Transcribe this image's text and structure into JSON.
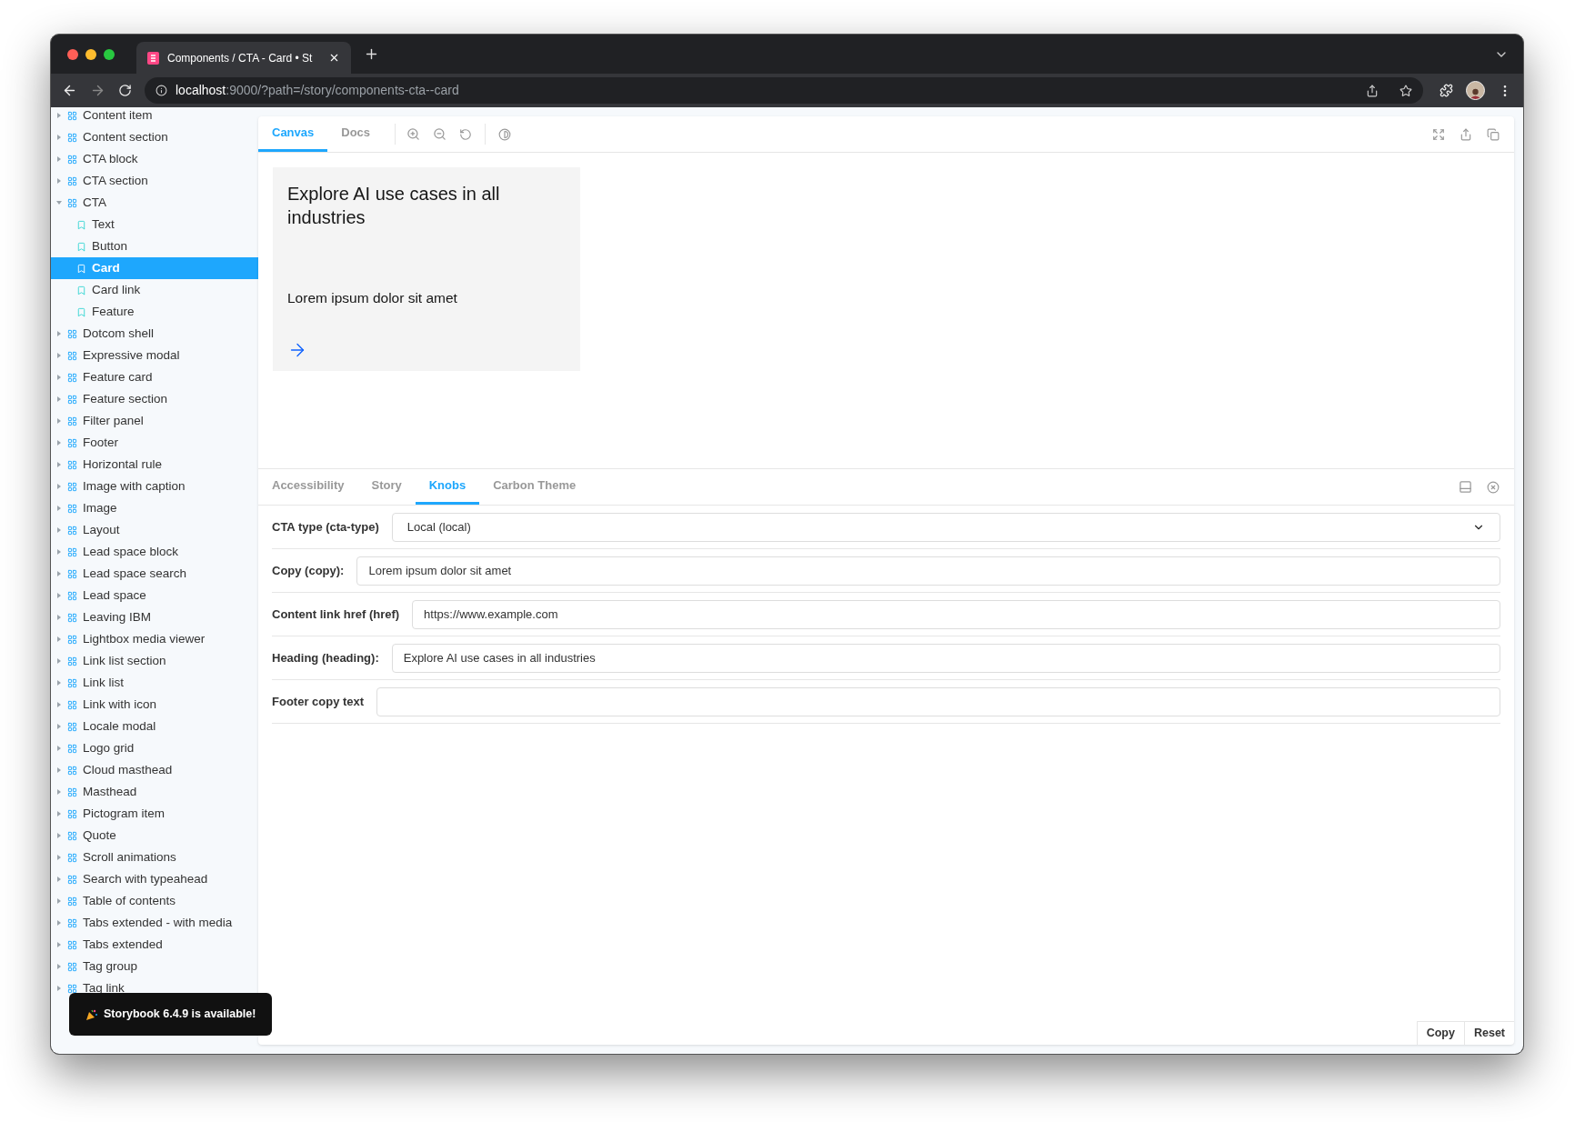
{
  "browser": {
    "tab_title": "Components / CTA - Card • St",
    "url": {
      "host": "localhost",
      "path": ":9000/?path=/story/components-cta--card"
    }
  },
  "sidebar": {
    "items": [
      {
        "label": "Content item",
        "kind": "component",
        "expanded": false
      },
      {
        "label": "Content section",
        "kind": "component",
        "expanded": false
      },
      {
        "label": "CTA block",
        "kind": "component",
        "expanded": false
      },
      {
        "label": "CTA section",
        "kind": "component",
        "expanded": false
      },
      {
        "label": "CTA",
        "kind": "component",
        "expanded": true,
        "children": [
          {
            "label": "Text",
            "kind": "story",
            "selected": false
          },
          {
            "label": "Button",
            "kind": "story",
            "selected": false
          },
          {
            "label": "Card",
            "kind": "story",
            "selected": true
          },
          {
            "label": "Card link",
            "kind": "story",
            "selected": false
          },
          {
            "label": "Feature",
            "kind": "story",
            "selected": false
          }
        ]
      },
      {
        "label": "Dotcom shell",
        "kind": "component",
        "expanded": false
      },
      {
        "label": "Expressive modal",
        "kind": "component",
        "expanded": false
      },
      {
        "label": "Feature card",
        "kind": "component",
        "expanded": false
      },
      {
        "label": "Feature section",
        "kind": "component",
        "expanded": false
      },
      {
        "label": "Filter panel",
        "kind": "component",
        "expanded": false
      },
      {
        "label": "Footer",
        "kind": "component",
        "expanded": false
      },
      {
        "label": "Horizontal rule",
        "kind": "component",
        "expanded": false
      },
      {
        "label": "Image with caption",
        "kind": "component",
        "expanded": false
      },
      {
        "label": "Image",
        "kind": "component",
        "expanded": false
      },
      {
        "label": "Layout",
        "kind": "component",
        "expanded": false
      },
      {
        "label": "Lead space block",
        "kind": "component",
        "expanded": false
      },
      {
        "label": "Lead space search",
        "kind": "component",
        "expanded": false
      },
      {
        "label": "Lead space",
        "kind": "component",
        "expanded": false
      },
      {
        "label": "Leaving IBM",
        "kind": "component",
        "expanded": false
      },
      {
        "label": "Lightbox media viewer",
        "kind": "component",
        "expanded": false
      },
      {
        "label": "Link list section",
        "kind": "component",
        "expanded": false
      },
      {
        "label": "Link list",
        "kind": "component",
        "expanded": false
      },
      {
        "label": "Link with icon",
        "kind": "component",
        "expanded": false
      },
      {
        "label": "Locale modal",
        "kind": "component",
        "expanded": false
      },
      {
        "label": "Logo grid",
        "kind": "component",
        "expanded": false
      },
      {
        "label": "Cloud masthead",
        "kind": "component",
        "expanded": false
      },
      {
        "label": "Masthead",
        "kind": "component",
        "expanded": false
      },
      {
        "label": "Pictogram item",
        "kind": "component",
        "expanded": false
      },
      {
        "label": "Quote",
        "kind": "component",
        "expanded": false
      },
      {
        "label": "Scroll animations",
        "kind": "component",
        "expanded": false
      },
      {
        "label": "Search with typeahead",
        "kind": "component",
        "expanded": false
      },
      {
        "label": "Table of contents",
        "kind": "component",
        "expanded": false
      },
      {
        "label": "Tabs extended - with media",
        "kind": "component",
        "expanded": false
      },
      {
        "label": "Tabs extended",
        "kind": "component",
        "expanded": false
      },
      {
        "label": "Tag group",
        "kind": "component",
        "expanded": false
      },
      {
        "label": "Tag link",
        "kind": "component",
        "expanded": false
      }
    ]
  },
  "toolbar": {
    "tabs": [
      {
        "label": "Canvas",
        "selected": true
      },
      {
        "label": "Docs",
        "selected": false
      }
    ]
  },
  "card": {
    "heading": "Explore AI use cases in all industries",
    "copy": "Lorem ipsum dolor sit amet"
  },
  "addons": {
    "tabs": [
      {
        "label": "Accessibility",
        "selected": false
      },
      {
        "label": "Story",
        "selected": false
      },
      {
        "label": "Knobs",
        "selected": true
      },
      {
        "label": "Carbon Theme",
        "selected": false
      }
    ],
    "knobs": [
      {
        "label": "CTA type (cta-type)",
        "kind": "select",
        "value": "Local (local)"
      },
      {
        "label": "Copy (copy):",
        "kind": "text",
        "value": "Lorem ipsum dolor sit amet"
      },
      {
        "label": "Content link href (href)",
        "kind": "text",
        "value": "https://www.example.com"
      },
      {
        "label": "Heading (heading):",
        "kind": "text",
        "value": "Explore AI use cases in all industries"
      },
      {
        "label": "Footer copy text",
        "kind": "text"
      }
    ],
    "buttons": [
      "Copy",
      "Reset"
    ]
  },
  "notification": "Storybook 6.4.9 is available!"
}
